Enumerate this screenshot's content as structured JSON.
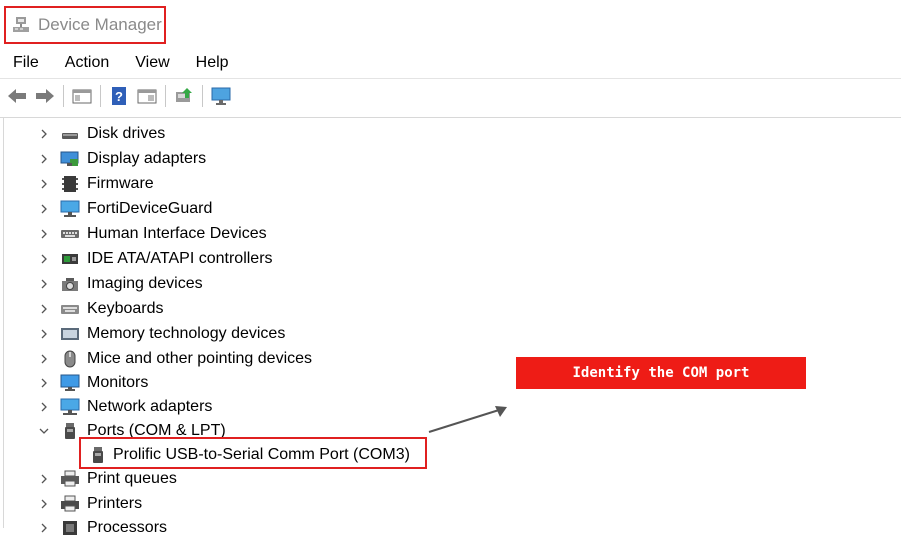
{
  "window": {
    "title": "Device Manager"
  },
  "menu": [
    "File",
    "Action",
    "View",
    "Help"
  ],
  "toolbar": [
    "back-arrow-icon",
    "forward-arrow-icon",
    "show-hide-console-tree-icon",
    "help-icon",
    "properties-icon",
    "update-driver-icon",
    "scan-hardware-changes-icon"
  ],
  "tree": {
    "categories": [
      {
        "label": "Disk drives",
        "icon": "disk-drive-icon",
        "expanded": false
      },
      {
        "label": "Display adapters",
        "icon": "display-adapter-icon",
        "expanded": false
      },
      {
        "label": "Firmware",
        "icon": "firmware-icon",
        "expanded": false
      },
      {
        "label": "FortiDeviceGuard",
        "icon": "fortidevice-icon",
        "expanded": false
      },
      {
        "label": "Human Interface Devices",
        "icon": "hid-icon",
        "expanded": false
      },
      {
        "label": "IDE ATA/ATAPI controllers",
        "icon": "ide-controller-icon",
        "expanded": false
      },
      {
        "label": "Imaging devices",
        "icon": "imaging-device-icon",
        "expanded": false
      },
      {
        "label": "Keyboards",
        "icon": "keyboard-icon",
        "expanded": false
      },
      {
        "label": "Memory technology devices",
        "icon": "memory-device-icon",
        "expanded": false
      },
      {
        "label": "Mice and other pointing devices",
        "icon": "mouse-icon",
        "expanded": false
      },
      {
        "label": "Monitors",
        "icon": "monitor-icon",
        "expanded": false
      },
      {
        "label": "Network adapters",
        "icon": "network-adapter-icon",
        "expanded": false
      },
      {
        "label": "Ports (COM & LPT)",
        "icon": "port-icon",
        "expanded": true,
        "children": [
          {
            "label": "Prolific USB-to-Serial Comm Port (COM3)",
            "icon": "serial-port-icon"
          }
        ]
      },
      {
        "label": "Print queues",
        "icon": "print-queue-icon",
        "expanded": false
      },
      {
        "label": "Printers",
        "icon": "printer-icon",
        "expanded": false
      },
      {
        "label": "Processors",
        "icon": "processor-icon",
        "expanded": false
      }
    ]
  },
  "annotation": {
    "callout_text": "Identify the COM port",
    "accent_color": "#ee1c16"
  }
}
